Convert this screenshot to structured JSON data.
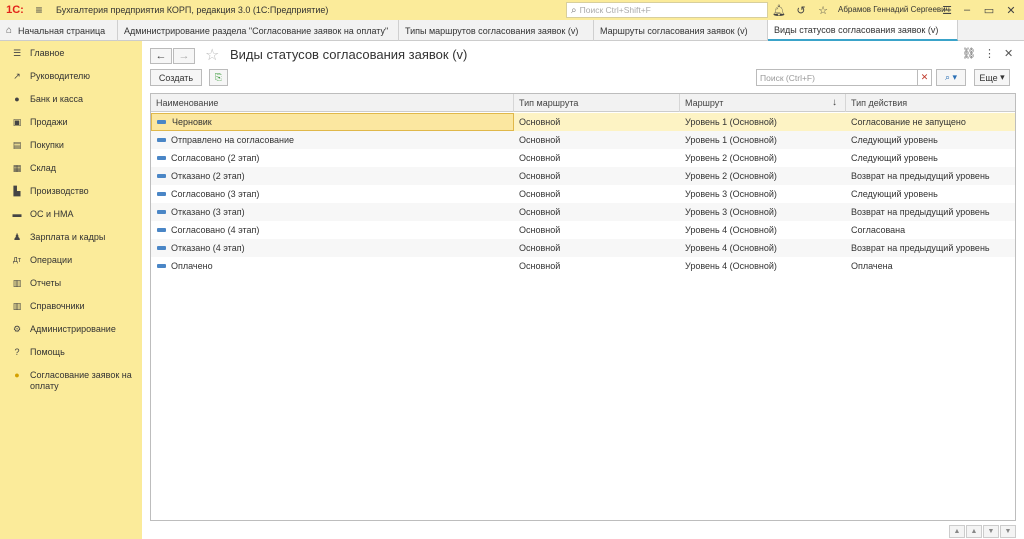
{
  "titlebar": {
    "logo": "1С:",
    "title": "Бухгалтерия предприятия КОРП, редакция 3.0  (1С:Предприятие)",
    "search_placeholder": "Поиск Ctrl+Shift+F",
    "user": "Абрамов Геннадий Сергеевич"
  },
  "tabs": [
    {
      "label": "Начальная страница"
    },
    {
      "label": "Администрирование раздела \"Согласование заявок на оплату\""
    },
    {
      "label": "Типы маршрутов согласования заявок (v)"
    },
    {
      "label": "Маршруты согласования заявок (v)"
    },
    {
      "label": "Виды статусов согласования заявок (v)"
    }
  ],
  "sidebar": {
    "items": [
      {
        "label": "Главное",
        "icon": "☰"
      },
      {
        "label": "Руководителю",
        "icon": "↗"
      },
      {
        "label": "Банк и касса",
        "icon": "●"
      },
      {
        "label": "Продажи",
        "icon": "▣"
      },
      {
        "label": "Покупки",
        "icon": "▤"
      },
      {
        "label": "Склад",
        "icon": "▦"
      },
      {
        "label": "Производство",
        "icon": "▙"
      },
      {
        "label": "ОС и НМА",
        "icon": "▬"
      },
      {
        "label": "Зарплата и кадры",
        "icon": "♟"
      },
      {
        "label": "Операции",
        "icon": "Дт"
      },
      {
        "label": "Отчеты",
        "icon": "▥"
      },
      {
        "label": "Справочники",
        "icon": "▥"
      },
      {
        "label": "Администрирование",
        "icon": "⚙"
      },
      {
        "label": "Помощь",
        "icon": "?"
      },
      {
        "label": "Согласование заявок на оплату",
        "icon": "●"
      }
    ]
  },
  "page": {
    "title": "Виды статусов согласования заявок (v)",
    "create_label": "Создать",
    "search_placeholder": "Поиск (Ctrl+F)",
    "more_label": "Еще"
  },
  "table": {
    "columns": [
      "Наименование",
      "Тип маршрута",
      "Маршрут",
      "Тип действия"
    ],
    "rows": [
      [
        "Черновик",
        "Основной",
        "Уровень 1 (Основной)",
        "Согласование не запущено"
      ],
      [
        "Отправлено на согласование",
        "Основной",
        "Уровень 1 (Основной)",
        "Следующий уровень"
      ],
      [
        "Согласовано (2 этап)",
        "Основной",
        "Уровень 2 (Основной)",
        "Следующий уровень"
      ],
      [
        "Отказано (2 этап)",
        "Основной",
        "Уровень 2 (Основной)",
        "Возврат на предыдущий уровень"
      ],
      [
        "Согласовано (3 этап)",
        "Основной",
        "Уровень 3 (Основной)",
        "Следующий уровень"
      ],
      [
        "Отказано (3 этап)",
        "Основной",
        "Уровень 3 (Основной)",
        "Возврат на предыдущий уровень"
      ],
      [
        "Согласовано (4 этап)",
        "Основной",
        "Уровень 4 (Основной)",
        "Согласована"
      ],
      [
        "Отказано (4 этап)",
        "Основной",
        "Уровень 4 (Основной)",
        "Возврат на предыдущий уровень"
      ],
      [
        "Оплачено",
        "Основной",
        "Уровень 4 (Основной)",
        "Оплачена"
      ]
    ]
  },
  "colors": {
    "sidebar_bg": "#fbeb9a",
    "active_tab_accent": "#3aa3c9",
    "selected_row": "#fdf3c4"
  }
}
